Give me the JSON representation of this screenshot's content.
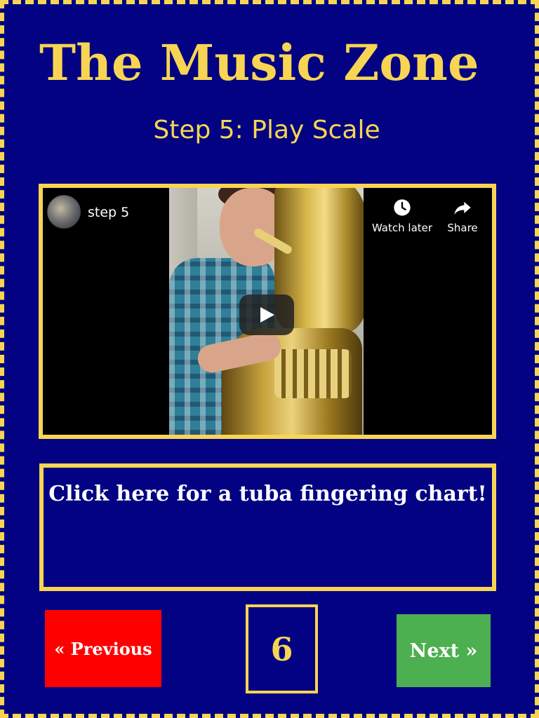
{
  "header": {
    "title": "The Music Zone",
    "subtitle": "Step 5: Play Scale"
  },
  "video": {
    "title": "step 5",
    "watch_later_label": "Watch later",
    "share_label": "Share",
    "icons": {
      "watch_later": "clock-icon",
      "share": "share-arrow-icon",
      "play": "play-icon",
      "avatar": "channel-avatar"
    }
  },
  "fingering_link": {
    "text": "Click here for a tuba fingering chart!"
  },
  "pagination": {
    "previous_label": "« Previous",
    "page_number": "6",
    "next_label": "Next »"
  },
  "colors": {
    "background": "#020282",
    "accent": "#f7d553",
    "previous_button": "#ff0000",
    "next_button": "#4caf50",
    "text": "#ffffff"
  }
}
